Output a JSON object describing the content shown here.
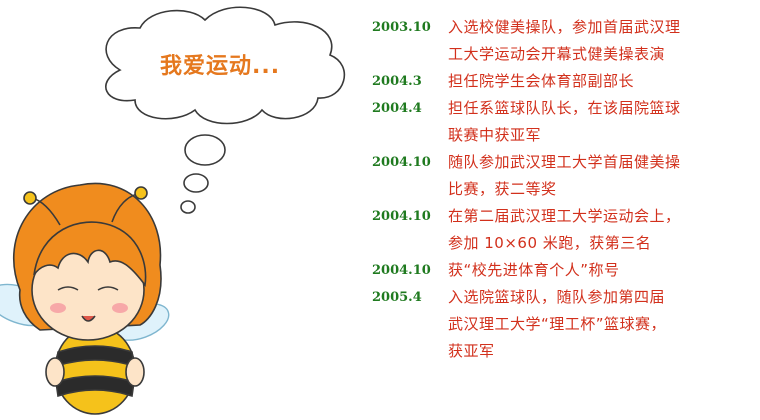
{
  "bubble": {
    "text": "我爱运动..."
  },
  "colors": {
    "date": "#1f7a1f",
    "description": "#d2301c",
    "bubble_text": "#e5781e"
  },
  "timeline": [
    {
      "date": "2003.10",
      "lines": [
        "入选校健美操队，参加首届武汉理",
        "工大学运动会开幕式健美操表演"
      ]
    },
    {
      "date": "2004.3",
      "lines": [
        "担任院学生会体育部副部长"
      ]
    },
    {
      "date": "2004.4",
      "lines": [
        "担任系篮球队队长，在该届院篮球",
        "联赛中获亚军"
      ]
    },
    {
      "date": "2004.10",
      "lines": [
        "随队参加武汉理工大学首届健美操",
        "比赛，获二等奖"
      ]
    },
    {
      "date": "2004.10",
      "lines": [
        "在第二届武汉理工大学运动会上，",
        "参加 10×60 米跑，获第三名"
      ]
    },
    {
      "date": "2004.10",
      "lines": [
        "获“校先进体育个人”称号"
      ]
    },
    {
      "date": "2005.4",
      "lines": [
        "入选院篮球队，随队参加第四届",
        "武汉理工大学“理工杯”篮球赛，",
        "获亚军"
      ]
    }
  ]
}
